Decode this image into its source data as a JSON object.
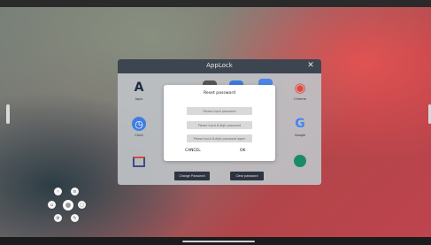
{
  "applock": {
    "title": "AppLock",
    "close_glyph": "✕",
    "apps": [
      {
        "label": "Apps",
        "glyph": "A",
        "icon": "app-store-icon",
        "color": "#1f2a44",
        "bg": "transparent"
      },
      {
        "label": "",
        "glyph": "●",
        "icon": "partial-app-icon",
        "color": "#2f6fd6",
        "bg": "transparent"
      },
      {
        "label": "",
        "glyph": "▤",
        "icon": "partial-app-icon-2",
        "color": "#3a3a3a",
        "bg": "#555555"
      },
      {
        "label": "",
        "glyph": "■",
        "icon": "partial-app-icon-3",
        "color": "#2f73d9",
        "bg": "#3b7be0"
      },
      {
        "label": "",
        "glyph": "■",
        "icon": "partial-app-icon-4",
        "color": "#2f73d9",
        "bg": "#4a86e6"
      },
      {
        "label": "Chrome",
        "glyph": "◉",
        "icon": "chrome-icon",
        "color": "#e5473a",
        "bg": "transparent"
      },
      {
        "label": "Clock",
        "glyph": "◷",
        "icon": "clock-icon",
        "color": "#ffffff",
        "bg": "#3f7ee0"
      },
      {
        "label": "Google",
        "glyph": "G",
        "icon": "google-icon",
        "color": "#4285f4",
        "bg": "transparent"
      }
    ],
    "change_password_label": "Change Password",
    "clear_password_label": "Clear password"
  },
  "dialog": {
    "title": "Reset password",
    "field1_placeholder": "Please input password",
    "field2_placeholder": "Please input 6-digit password",
    "field3_placeholder": "Please input 6-digit password again",
    "cancel_label": "CANCEL",
    "ok_label": "OK"
  },
  "floating_controls": {
    "buttons": [
      "back-icon",
      "home-icon",
      "menu-icon",
      "screenshot-icon",
      "settings-icon",
      "pen-icon"
    ]
  }
}
